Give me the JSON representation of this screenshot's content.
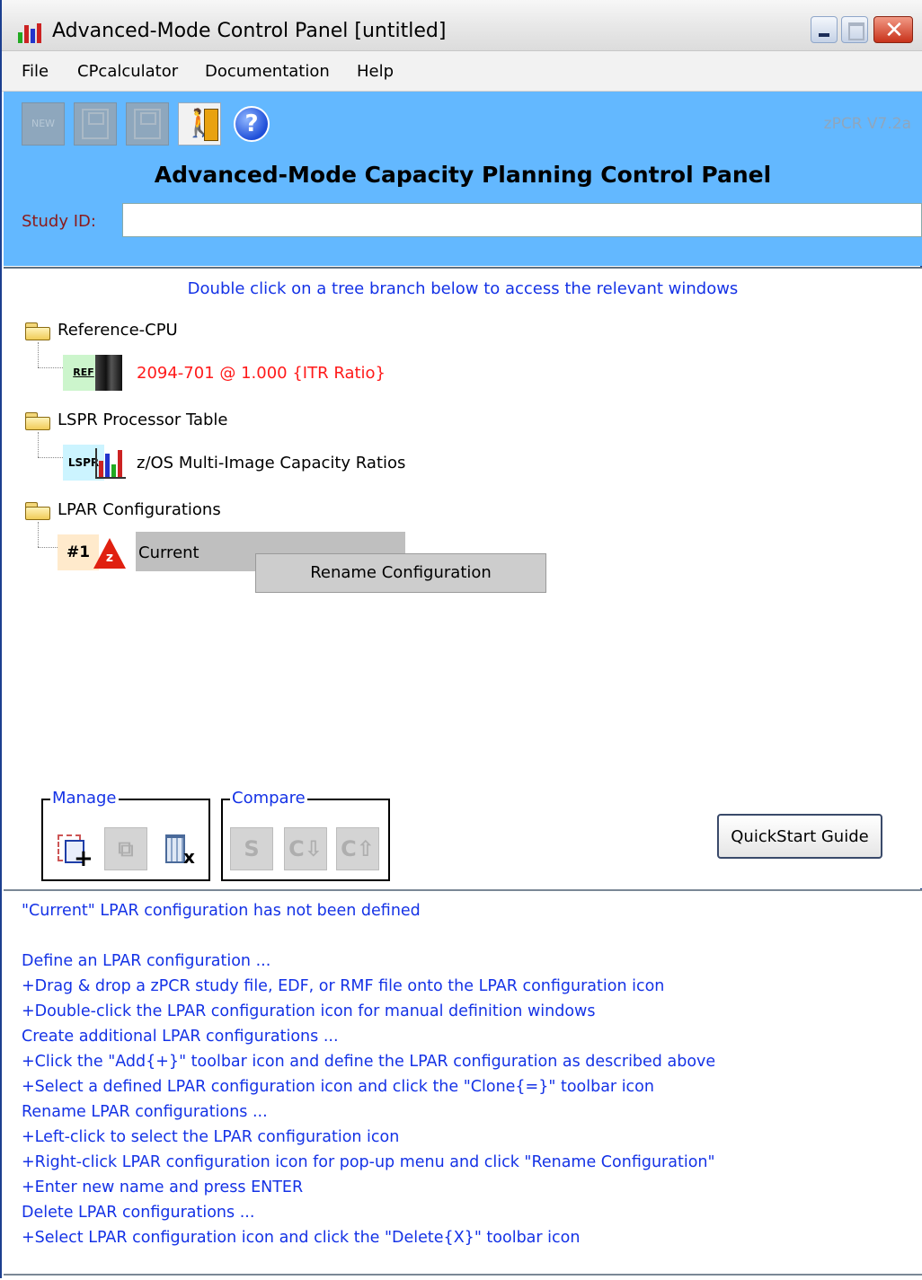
{
  "window": {
    "title": "Advanced-Mode Control Panel [untitled]"
  },
  "menu": [
    "File",
    "CPcalculator",
    "Documentation",
    "Help"
  ],
  "toolbar": {
    "new_label": "NEW",
    "version": "zPCR V7.2a"
  },
  "header": {
    "title": "Advanced-Mode Capacity Planning Control Panel",
    "study_label": "Study ID:",
    "study_value": ""
  },
  "tree": {
    "hint": "Double click on a tree branch below to access the relevant windows",
    "reference_cpu": {
      "label": "Reference-CPU",
      "ref_tag": "REF",
      "value": "2094-701 @ 1.000 {ITR Ratio}"
    },
    "lspr": {
      "label": "LSPR Processor Table",
      "tag": "LSPR",
      "value": "z/OS Multi-Image Capacity Ratios"
    },
    "lpar": {
      "label": "LPAR Configurations",
      "config_number": "#1",
      "config_name": "Current",
      "badge": "z"
    }
  },
  "context_menu": {
    "item": "Rename Configuration"
  },
  "groups": {
    "manage": "Manage",
    "compare": "Compare",
    "compare_buttons": [
      "S",
      "C⇩",
      "C⇧"
    ]
  },
  "quickstart_label": "QuickStart Guide",
  "messages": [
    "\"Current\" LPAR configuration has not been defined",
    "",
    "Define an LPAR configuration ...",
    "   +Drag & drop a zPCR study file, EDF, or RMF file onto the LPAR configuration icon",
    "   +Double-click the LPAR configuration icon for manual definition windows",
    "Create additional LPAR configurations ...",
    "  +Click the \"Add{+}\" toolbar icon and define the LPAR configuration as described above",
    "  +Select a defined LPAR configuration icon and click the \"Clone{=}\" toolbar icon",
    "Rename LPAR configurations ...",
    "  +Left-click to select the LPAR configuration icon",
    "  +Right-click LPAR configuration icon for pop-up menu and click \"Rename Configuration\"",
    "  +Enter new name and press ENTER",
    "Delete LPAR configurations ...",
    "  +Select LPAR configuration icon and click the \"Delete{X}\" toolbar icon"
  ],
  "colors": {
    "header_bg": "#63b8ff",
    "link_blue": "#1432e6",
    "ref_red": "#ff1a1a",
    "study_label": "#8b1a1a"
  }
}
